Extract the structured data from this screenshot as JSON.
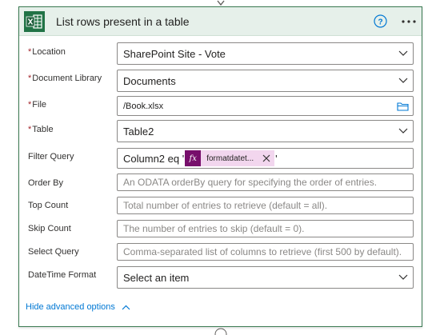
{
  "action": {
    "title": "List rows present in a table"
  },
  "fields": [
    {
      "label": "Location",
      "required": true,
      "value": "SharePoint Site - Vote",
      "kind": "dropdown"
    },
    {
      "label": "Document Library",
      "required": true,
      "value": "Documents",
      "kind": "dropdown"
    },
    {
      "label": "File",
      "required": true,
      "value": "/Book.xlsx",
      "kind": "file"
    },
    {
      "label": "Table",
      "required": true,
      "value": "Table2",
      "kind": "dropdown"
    },
    {
      "label": "Filter Query",
      "required": false,
      "prefix": "Column2 eq '",
      "token_label": "formatdatet...",
      "suffix": "'",
      "kind": "expression"
    },
    {
      "label": "Order By",
      "required": false,
      "placeholder": "An ODATA orderBy query for specifying the order of entries.",
      "kind": "text"
    },
    {
      "label": "Top Count",
      "required": false,
      "placeholder": "Total number of entries to retrieve (default = all).",
      "kind": "text"
    },
    {
      "label": "Skip Count",
      "required": false,
      "placeholder": "The number of entries to skip (default = 0).",
      "kind": "text"
    },
    {
      "label": "Select Query",
      "required": false,
      "placeholder": "Comma-separated list of columns to retrieve (first 500 by default).",
      "kind": "text"
    },
    {
      "label": "DateTime Format",
      "required": false,
      "value": "Select an item",
      "kind": "dropdown"
    }
  ],
  "required_marker": "*",
  "token_icon": "fx",
  "advanced_link": "Hide advanced options",
  "icons": {
    "app": "excel-icon",
    "help": "help-icon",
    "more": "more-options-icon",
    "dropdown": "chevron-down-icon",
    "file": "folder-icon",
    "remove_token": "close-icon",
    "collapse": "chevron-up-icon"
  },
  "colors": {
    "header_bg": "#e6f0ea",
    "card_border": "#3a7a52",
    "excel_green": "#217346",
    "link_blue": "#0078d4",
    "required_red": "#a4262c",
    "token_bg": "#f2d6ee",
    "token_icon_bg": "#770f6b"
  }
}
